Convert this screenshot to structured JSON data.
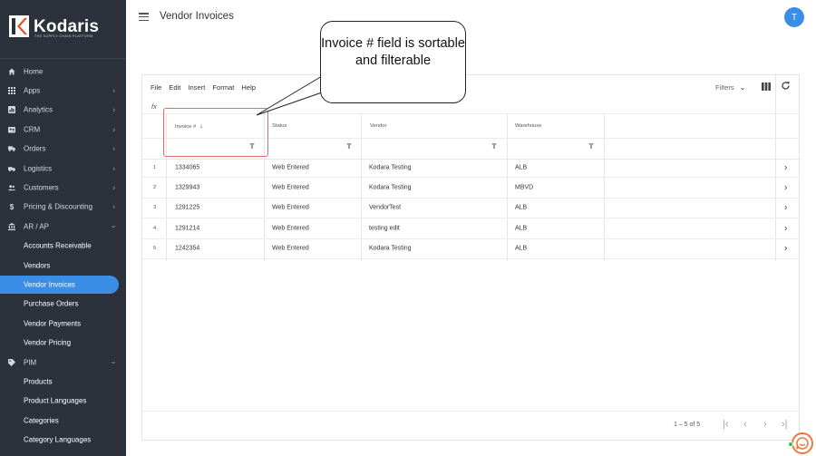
{
  "brand": {
    "name": "Kodaris",
    "tagline": "THE SUPPLY CHAIN PLATFORM"
  },
  "sidebar": {
    "items": [
      {
        "label": "Home",
        "icon": "home-icon",
        "chevron": false
      },
      {
        "label": "Apps",
        "icon": "apps-grid-icon",
        "chevron": true
      },
      {
        "label": "Analytics",
        "icon": "analytics-icon",
        "chevron": true
      },
      {
        "label": "CRM",
        "icon": "crm-icon",
        "chevron": true
      },
      {
        "label": "Orders",
        "icon": "truck-icon",
        "chevron": true
      },
      {
        "label": "Logistics",
        "icon": "logistics-icon",
        "chevron": true
      },
      {
        "label": "Customers",
        "icon": "customers-icon",
        "chevron": true
      },
      {
        "label": "Pricing & Discounting",
        "icon": "dollar-icon",
        "chevron": true
      },
      {
        "label": "AR / AP",
        "icon": "bank-icon",
        "chevron": true,
        "expanded": true
      },
      {
        "label": "Accounts Receivable",
        "sub": true
      },
      {
        "label": "Vendors",
        "sub": true
      },
      {
        "label": "Vendor Invoices",
        "sub": true,
        "active": true
      },
      {
        "label": "Purchase Orders",
        "sub": true
      },
      {
        "label": "Vendor Payments",
        "sub": true
      },
      {
        "label": "Vendor Pricing",
        "sub": true
      },
      {
        "label": "PIM",
        "icon": "tag-icon",
        "chevron": true,
        "expanded": true
      },
      {
        "label": "Products",
        "sub": true
      },
      {
        "label": "Product Languages",
        "sub": true
      },
      {
        "label": "Categories",
        "sub": true
      },
      {
        "label": "Category Languages",
        "sub": true
      }
    ]
  },
  "header": {
    "title": "Vendor Invoices",
    "avatar_initial": "T"
  },
  "toolbar": {
    "menu": [
      "File",
      "Edit",
      "Insert",
      "Format",
      "Help"
    ],
    "filters_label": "Filters",
    "fx_label": "fx"
  },
  "table": {
    "columns": [
      "Invoice #",
      "Status",
      "Vendor",
      "Warehouse"
    ],
    "sort_column": "Invoice #",
    "sort_direction": "descending",
    "rows": [
      {
        "num": "1",
        "invoice": "1334065",
        "status": "Web Entered",
        "vendor": "Kodara Testing",
        "warehouse": "ALB"
      },
      {
        "num": "2",
        "invoice": "1329943",
        "status": "Web Entered",
        "vendor": "Kodara Testing",
        "warehouse": "MBVD"
      },
      {
        "num": "3",
        "invoice": "1291225",
        "status": "Web Entered",
        "vendor": "VendorTest",
        "warehouse": "ALB"
      },
      {
        "num": "4",
        "invoice": "1291214",
        "status": "Web Entered",
        "vendor": "testing edit",
        "warehouse": "ALB"
      },
      {
        "num": "5",
        "invoice": "1242354",
        "status": "Web Entered",
        "vendor": "Kodara Testing",
        "warehouse": "ALB"
      }
    ]
  },
  "pager": {
    "range_text": "1 – 5 of 5"
  },
  "callout": {
    "text": "Invoice # field is sortable and filterable"
  },
  "colors": {
    "sidebar_bg": "#2b323b",
    "accent": "#3a8ee6",
    "highlight": "#e06b6b",
    "chat": "#e87940"
  }
}
